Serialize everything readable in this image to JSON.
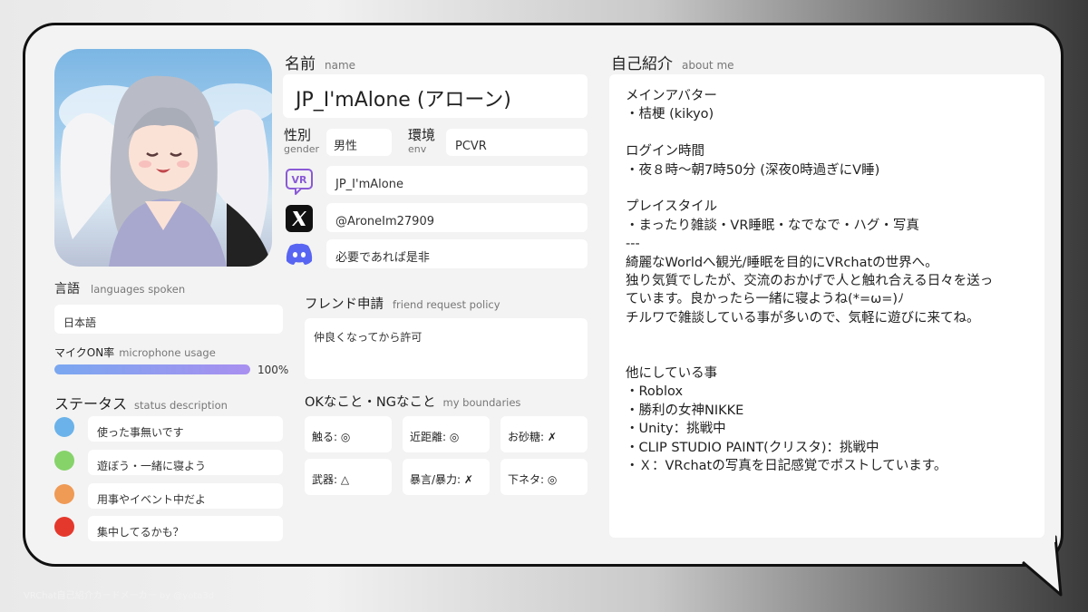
{
  "name": {
    "label": "名前",
    "sublabel": "name",
    "value": "JP_I'mAlone (アローン)"
  },
  "gender": {
    "label": "性別",
    "sublabel": "gender",
    "value": "男性"
  },
  "env": {
    "label": "環境",
    "sublabel": "env",
    "value": "PCVR"
  },
  "vrchat": {
    "icon": "vrchat-icon",
    "value": "JP_I'mAlone"
  },
  "x": {
    "icon": "x-logo-icon",
    "value": "@AroneIm27909"
  },
  "discord": {
    "icon": "discord-icon",
    "value": "必要であれば是非"
  },
  "languages": {
    "label": "言語",
    "sublabel": "languages spoken",
    "value": "日本語"
  },
  "mic": {
    "label": "マイクON率",
    "sublabel": "microphone usage",
    "value_text": "100%",
    "fraction": 1.0
  },
  "status": {
    "label": "ステータス",
    "sublabel": "status description",
    "items": [
      {
        "color": "#6bb2ea",
        "text": "使った事無いです"
      },
      {
        "color": "#86d36a",
        "text": "遊ぼう・一緒に寝よう"
      },
      {
        "color": "#ef9a55",
        "text": "用事やイベント中だよ"
      },
      {
        "color": "#e5382c",
        "text": "集中してるかも？"
      }
    ]
  },
  "friend_request": {
    "label": "フレンド申請",
    "sublabel": "friend request policy",
    "value": "仲良くなってから許可"
  },
  "boundaries": {
    "label": "OKなこと・NGなこと",
    "sublabel": "my boundaries",
    "items": [
      "触る: ◎",
      "近距離: ◎",
      "お砂糖: ✗",
      "武器: △",
      "暴言/暴力: ✗",
      "下ネタ: ◎"
    ]
  },
  "about": {
    "label": "自己紹介",
    "sublabel": "about me",
    "lines": [
      "メインアバター",
      "・桔梗 (kikyo)",
      "",
      "ログイン時間",
      "・夜８時～朝7時50分 (深夜0時過ぎにV睡)",
      "",
      "プレイスタイル",
      "・まったり雑談・VR睡眠・なでなで・ハグ・写真",
      "---",
      "綺麗なWorldへ観光/睡眠を目的にVRchatの世界へ。",
      "独り気質でしたが、交流のおかげで人と触れ合える日々を送っ",
      "ています。良かったら一緒に寝ようね(*=ω=)ﾉ",
      "チルワで雑談している事が多いので、気軽に遊びに来てね。",
      "",
      "",
      "他にしている事",
      "・Roblox",
      "・勝利の女神NIKKE",
      "・Unity：挑戦中",
      "・CLIP STUDIO PAINT(クリスタ)：挑戦中",
      "・Ｘ：VRchatの写真を日記感覚でポストしています。"
    ]
  },
  "footer": "VRChat自己紹介カードメーカー by @yota3d"
}
